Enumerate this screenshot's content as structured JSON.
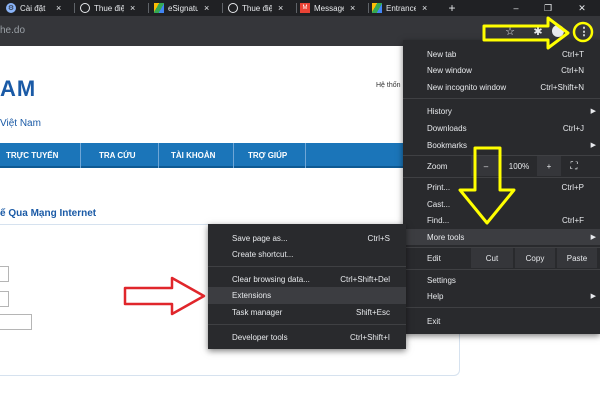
{
  "tabs": [
    {
      "title": "Cài đặt",
      "favicon": "chrome-settings-icon",
      "color": "#8ab4f8"
    },
    {
      "title": "Thue điện tử",
      "favicon": "globe-icon",
      "color": "#e8eaed"
    },
    {
      "title": "eSignature",
      "favicon": "drive-icon",
      "color": "#34a853"
    },
    {
      "title": "Thue điện tử",
      "favicon": "globe-icon",
      "color": "#e8eaed"
    },
    {
      "title": "Message",
      "favicon": "gmail-icon",
      "color": "#ea4335"
    },
    {
      "title": "Entrance",
      "favicon": "drive-icon",
      "color": "#34a853"
    }
  ],
  "tab_close_glyph": "×",
  "new_tab_glyph": "+",
  "window_controls": {
    "minimize": "–",
    "restore": "❐",
    "close": "✕"
  },
  "toolbar": {
    "url": "he.do",
    "star_glyph": "☆",
    "extensions_glyph": "✱",
    "menu_glyph": "⋮"
  },
  "site": {
    "title": "AM",
    "subtitle": "Việt Nam",
    "header_right": "Hệ thốn",
    "nav": [
      "TRỰC TUYẾN",
      "TRA CỨU",
      "TÀI KHOẢN",
      "TRỢ GIÚP"
    ],
    "section_title": "ế Qua Mạng Internet"
  },
  "menu": {
    "new_tab": {
      "label": "New tab",
      "shortcut": "Ctrl+T"
    },
    "new_window": {
      "label": "New window",
      "shortcut": "Ctrl+N"
    },
    "new_incognito": {
      "label": "New incognito window",
      "shortcut": "Ctrl+Shift+N"
    },
    "history": {
      "label": "History"
    },
    "downloads": {
      "label": "Downloads",
      "shortcut": "Ctrl+J"
    },
    "bookmarks": {
      "label": "Bookmarks"
    },
    "zoom": {
      "label": "Zoom",
      "minus": "–",
      "value": "100%",
      "plus": "+",
      "fullscreen_glyph": "⛶"
    },
    "print": {
      "label": "Print...",
      "shortcut": "Ctrl+P"
    },
    "cast": {
      "label": "Cast..."
    },
    "find": {
      "label": "Find...",
      "shortcut": "Ctrl+F"
    },
    "more_tools": {
      "label": "More tools"
    },
    "edit": {
      "label": "Edit",
      "cut": "Cut",
      "copy": "Copy",
      "paste": "Paste"
    },
    "settings": {
      "label": "Settings"
    },
    "help": {
      "label": "Help"
    },
    "exit": {
      "label": "Exit"
    },
    "arrow_glyph": "▶"
  },
  "submenu": {
    "save_page": {
      "label": "Save page as...",
      "shortcut": "Ctrl+S"
    },
    "create_shortcut": {
      "label": "Create shortcut..."
    },
    "clear_data": {
      "label": "Clear browsing data...",
      "shortcut": "Ctrl+Shift+Del"
    },
    "extensions": {
      "label": "Extensions"
    },
    "task_manager": {
      "label": "Task manager",
      "shortcut": "Shift+Esc"
    },
    "dev_tools": {
      "label": "Developer tools",
      "shortcut": "Ctrl+Shift+I"
    }
  },
  "colors": {
    "annotation_yellow": "#ffff00",
    "annotation_red": "#e0262b",
    "menu_bg": "#292a2d",
    "nav_blue": "#1b75b9"
  }
}
